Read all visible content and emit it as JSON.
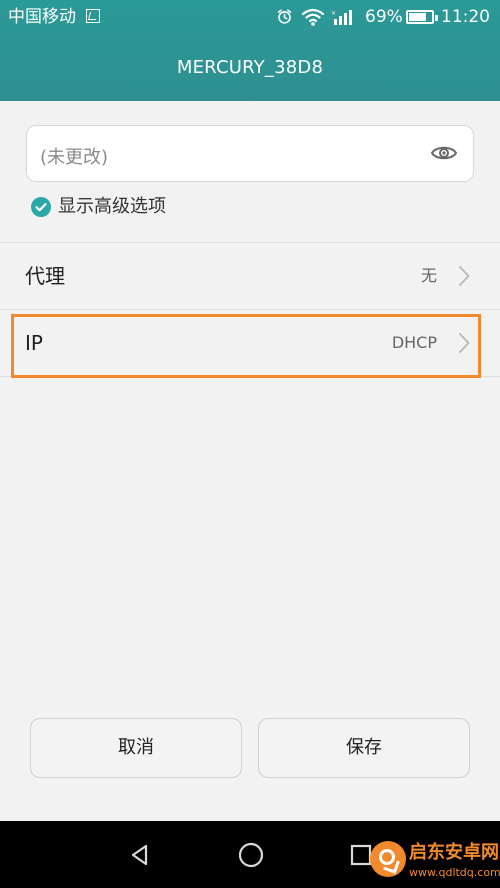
{
  "status_bar": {
    "carrier": "中国移动",
    "battery_percent": "69%",
    "battery_level": 0.69,
    "time": "11:20"
  },
  "header": {
    "title": "MERCURY_38D8"
  },
  "password_field": {
    "placeholder": "(未更改)"
  },
  "advanced_options": {
    "label": "显示高级选项",
    "checked": true
  },
  "settings_rows": [
    {
      "label": "代理",
      "value": "无"
    },
    {
      "label": "IP",
      "value": "DHCP"
    }
  ],
  "buttons": {
    "cancel": "取消",
    "save": "保存"
  },
  "watermark": {
    "title": "启东安卓网",
    "url": "www.qdltdq.com"
  },
  "colors": {
    "header": "#2f8f90",
    "accent": "#2aa8a6",
    "highlight": "#f28a2d"
  },
  "icons": {
    "status_carrier": "sim-card-icon",
    "status_alarm": "alarm-icon",
    "status_wifi": "wifi-icon",
    "status_signal": "signal-icon",
    "status_battery": "battery-icon",
    "password_toggle": "eye-icon",
    "row_chevron": "chevron-right-icon",
    "nav_back": "back-icon",
    "nav_home": "home-icon",
    "nav_recent": "recent-apps-icon"
  }
}
